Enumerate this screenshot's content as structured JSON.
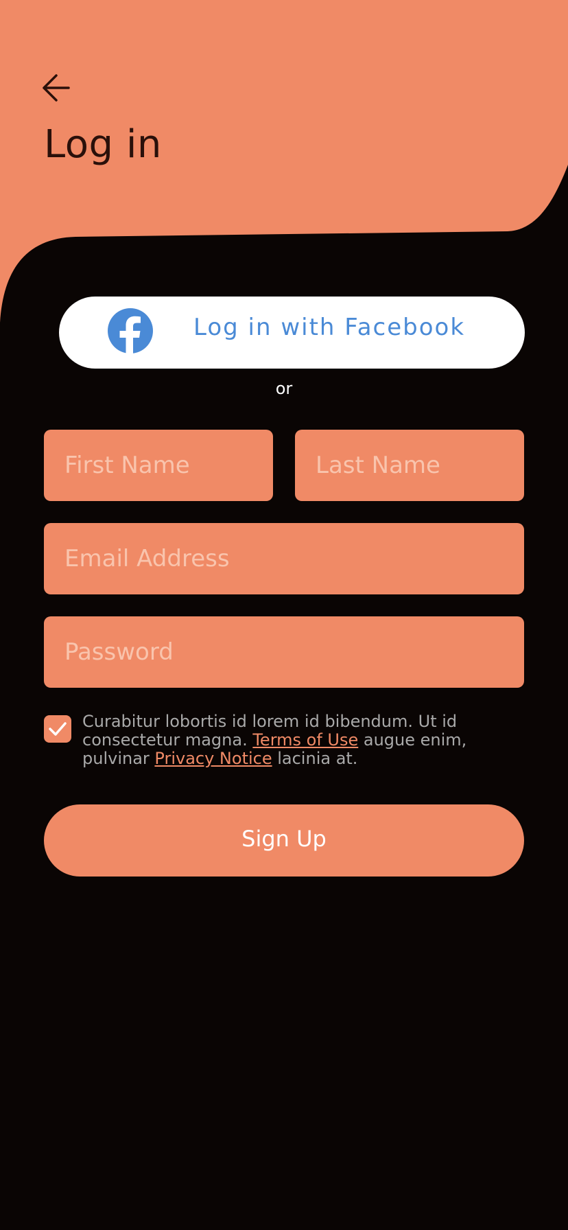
{
  "header": {
    "title": "Log in",
    "back_icon": "arrow-left-icon"
  },
  "facebook": {
    "label": "Log in with Facebook",
    "icon": "facebook-icon",
    "color": "#4a8ad6"
  },
  "divider": {
    "text": "or"
  },
  "form": {
    "first_name": {
      "placeholder": "First Name",
      "value": ""
    },
    "last_name": {
      "placeholder": "Last Name",
      "value": ""
    },
    "email": {
      "placeholder": "Email Address",
      "value": ""
    },
    "password": {
      "placeholder": "Password",
      "value": ""
    }
  },
  "consent": {
    "checked": true,
    "text_1": "Curabitur lobortis id lorem id bibendum. Ut id consectetur magna. ",
    "terms_link": "Terms of Use",
    "text_2": " augue enim, pulvinar ",
    "privacy_link": "Privacy Notice",
    "text_3": " lacinia at."
  },
  "submit": {
    "label": "Sign Up"
  },
  "colors": {
    "accent": "#f08a66",
    "background": "#0a0504",
    "title": "#2a100a",
    "placeholder": "#f9c4ad",
    "body_text": "#a9a9a9"
  }
}
